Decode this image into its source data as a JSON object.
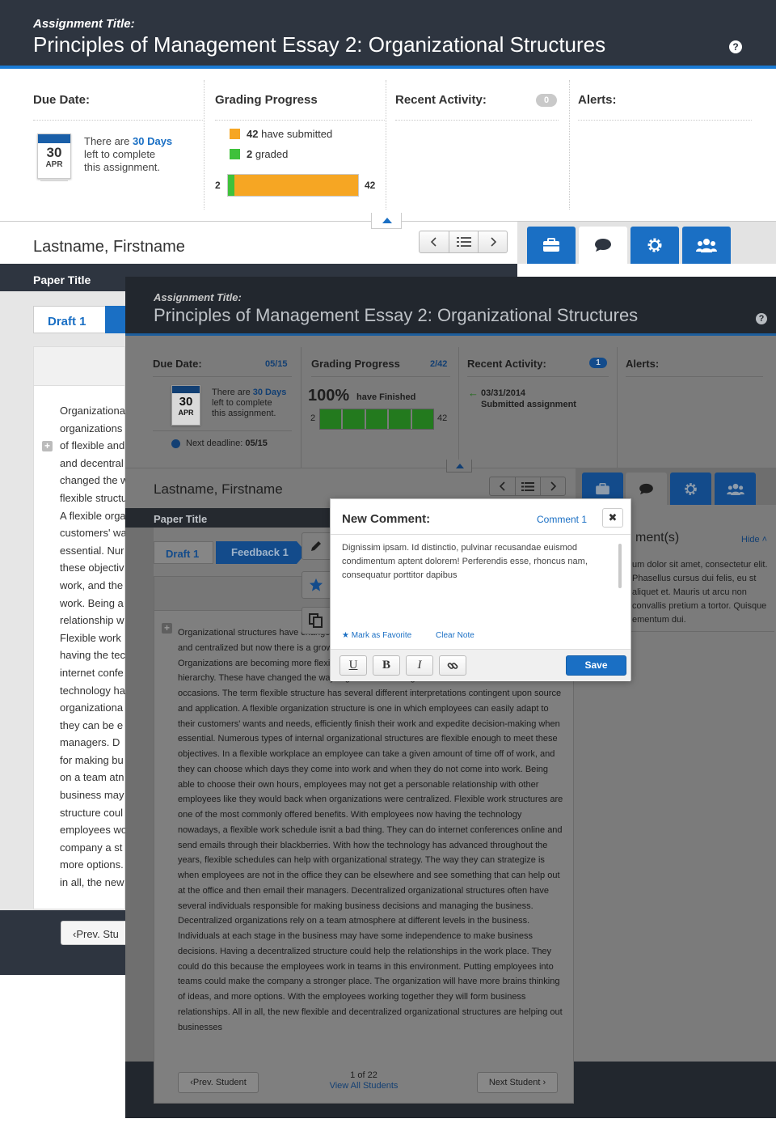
{
  "header": {
    "kicker": "Assignment Title:",
    "title": "Principles of Management Essay 2: Organizational Structures",
    "help": "?"
  },
  "stats": {
    "due": {
      "heading": "Due Date:",
      "cal_day": "30",
      "cal_month": "APR",
      "line_pre": "There are",
      "line_em": "30 Days",
      "line2": "left to complete",
      "line3": "this assignment."
    },
    "grading": {
      "heading": "Grading Progress",
      "submitted_count": "42",
      "submitted_label": "have submitted",
      "graded_count": "2",
      "graded_label": "graded",
      "bar_left": "2",
      "bar_right": "42",
      "graded_fraction": 0.048,
      "submitted_color": "#f6a623",
      "graded_color": "#3fc13b"
    },
    "activity": {
      "heading": "Recent Activity:",
      "badge": "0"
    },
    "alerts": {
      "heading": "Alerts:"
    }
  },
  "student": {
    "name": "Lastname, Firstname"
  },
  "paper": {
    "title": "Paper Title",
    "draft_label": "Draft 1"
  },
  "back_essay_lines": [
    "Organizationa",
    "organizations",
    "of flexible and",
    "and decentral",
    "changed the w",
    "flexible structu",
    "A flexible orga",
    "customers' wa",
    "essential. Nur",
    "these objectiv",
    "work, and the",
    "work.  Being a",
    "relationship w",
    "Flexible work",
    "having the tec",
    "internet confe",
    "technology ha",
    "organizationa",
    "they can be e",
    "managers.  D",
    "for making bu",
    "on a team atn",
    "business may",
    "structure coul",
    "employees wo",
    "company a st",
    "more options.",
    "in all, the new"
  ],
  "back_footer": {
    "prev_label": "‹Prev. Stu"
  },
  "overlay": {
    "header": {
      "kicker": "Assignment Title:",
      "title": "Principles of Management Essay 2: Organizational Structures"
    },
    "due": {
      "heading": "Due Date:",
      "ratio": "05/15",
      "cal_day": "30",
      "cal_month": "APR",
      "line_pre": "There are",
      "line_em": "30 Days",
      "line2": "left to complete",
      "line3": "this assignment.",
      "next_label": "Next deadline:",
      "next_value": "05/15"
    },
    "grading": {
      "heading": "Grading Progress",
      "ratio": "2/42",
      "percent": "100%",
      "finished_label": "have Finished",
      "bar_left": "2",
      "bar_right": "42",
      "segments": 5
    },
    "activity": {
      "heading": "Recent Activity:",
      "badge": "1",
      "date": "03/31/2014",
      "desc": "Submitted assignment"
    },
    "alerts": {
      "heading": "Alerts:"
    },
    "student_name": "Lastname, Firstname",
    "paper_title": "Paper Title",
    "draft_label": "Draft 1",
    "feedback_label": "Feedback 1",
    "comment_pane": {
      "heading": "ment(s)",
      "hide": "Hide ˄",
      "text": "um dolor sit amet, consectetur elit. Phasellus cursus dui felis, eu st aliquet et. Mauris ut arcu non convallis pretium a tortor. Quisque ementum dui."
    },
    "essay": "Organizational structures have changed a lot in recent years. Most organizations were once rigid and centralized but now there is a growing trend of flexible and decentralized structures. Organizations are becoming more flexible and decentralized with relationships instead of hierarchy. These have changed the way organization strategize and their outlook on several occasions.  The term flexible structure has several different interpretations contingent upon source and application. A flexible organization structure is one in which employees  can easily adapt to their customers' wants and needs, efficiently finish their work and expedite decision-making when essential. Numerous types of internal organizational structures are flexible enough to meet these objectives.  In a flexible workplace an employee can take a given amount of time off of work, and they can choose which days they come into work and when they do not come into work.  Being able to choose their own hours, employees may not get a personable relationship with other employees like they would back when organizations were centralized.  Flexible work structures are one of the most commonly offered benefits.  With employees now having the technology nowadays, a flexible work schedule isnit a bad thing.  They can do internet conferences online and send emails through their blackberries.  With how the technology has advanced throughout the years, flexible schedules can help with organizational strategy.  The way they can strategize is when employees are not in the office they can be elsewhere and see something that can help out at the office and then email their managers.  Decentralized organizational structures often have several individuals responsible for making business decisions and managing the business. Decentralized organizations rely on a team atmosphere at different levels in the business. Individuals at each stage in the business may have some independence to make business decisions.  Having a decentralized structure could help the relationships in the work place.  They could do this because the employees work in teams in this environment.  Putting employees into teams could make the company a stronger place.  The organization will have more brains thinking of ideas, and more options.  With the employees working together they will form business relationships.  All in all, the new flexible and decentralized organizational structures are helping out businesses",
    "footer": {
      "prev_label": "‹Prev. Student",
      "page_info": "1 of 22",
      "view_all": "View All Students",
      "next_label": "Next Student ›"
    }
  },
  "modal": {
    "title": "New Comment:",
    "comment_label": "Comment  1",
    "close": "✖",
    "body": "Dignissim ipsam. Id distinctio, pulvinar recusandae euismod condimentum aptent dolorem! Perferendis esse, rhoncus nam, consequatur porttitor dapibus",
    "favorite": "Mark as Favorite",
    "clear": "Clear Note",
    "underline": "U",
    "bold": "B",
    "italic": "I",
    "save": "Save"
  },
  "colors": {
    "accent": "#1a6fc4",
    "header_bg": "#2e3540",
    "header_rule": "#1a7ad4"
  }
}
